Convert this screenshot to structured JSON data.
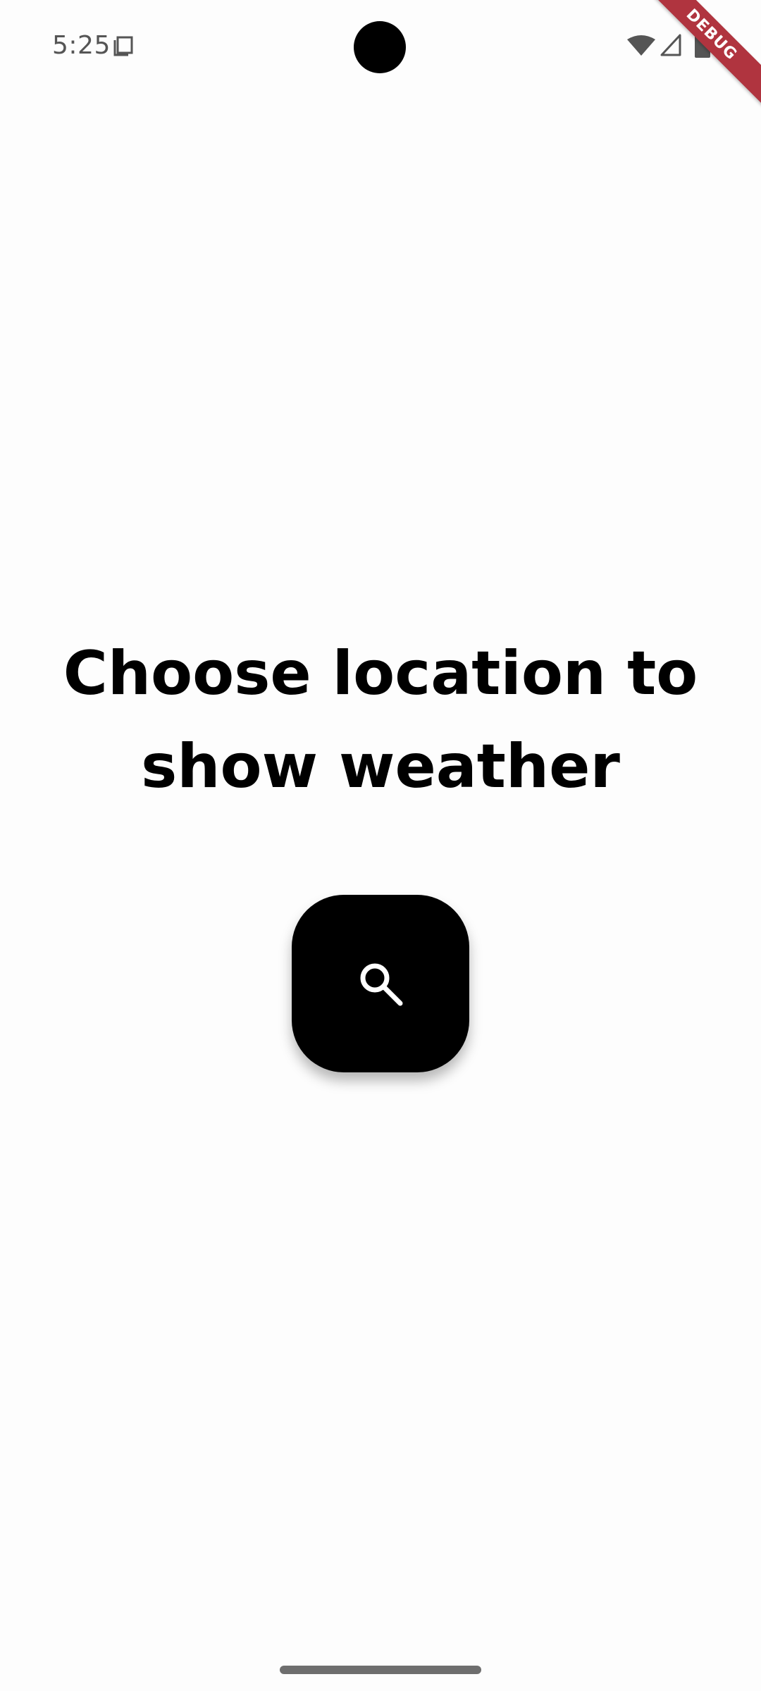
{
  "status_bar": {
    "time": "5:25",
    "icons": [
      "screenshot-icon",
      "wifi-icon",
      "signal-icon",
      "battery-icon"
    ]
  },
  "debug_banner": {
    "label": "DEBUG",
    "color": "#b0343f"
  },
  "main": {
    "title": "Choose location to show weather",
    "search_button": {
      "icon": "search-icon",
      "background": "#000000",
      "icon_color": "#ffffff"
    }
  },
  "colors": {
    "background": "#fdfdfd",
    "text": "#000000"
  }
}
